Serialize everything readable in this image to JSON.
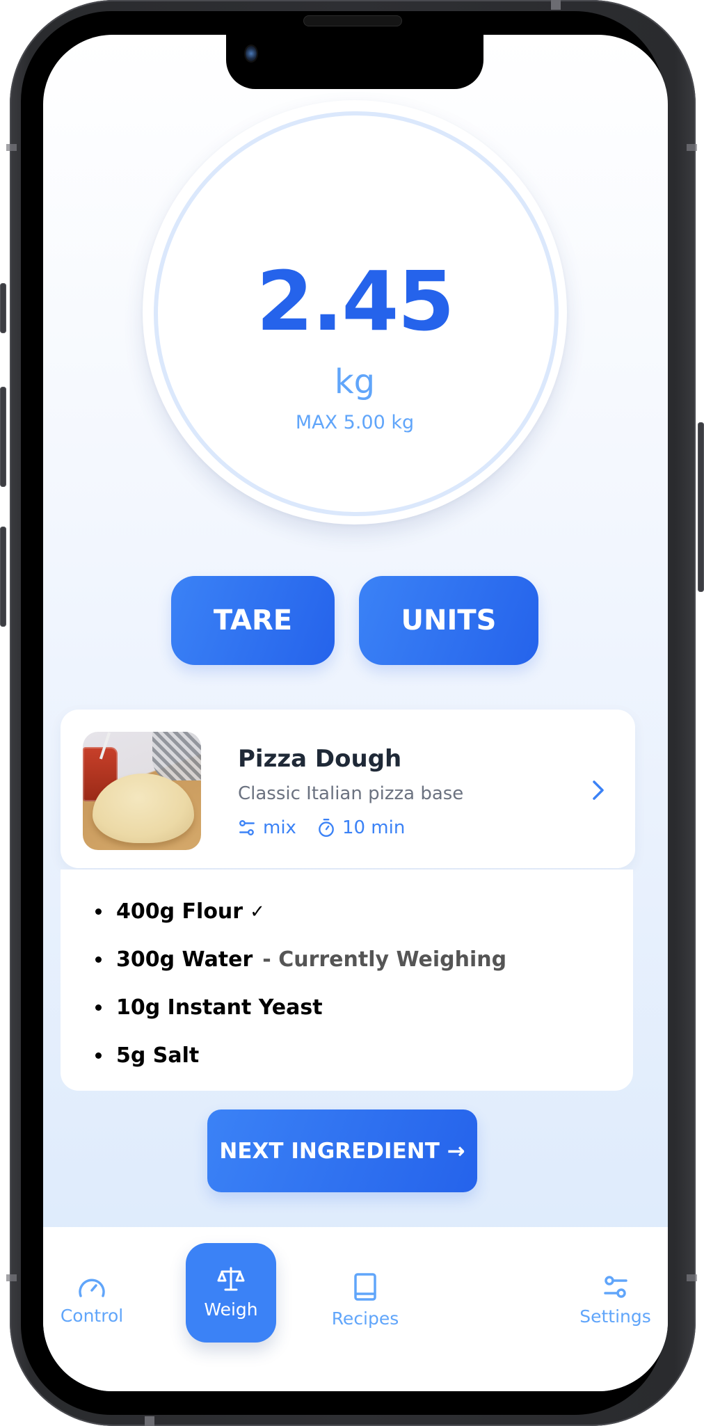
{
  "scale": {
    "weight_value": "2.45",
    "unit": "kg",
    "max_label": "MAX 5.00 kg",
    "capacity_fraction": 0.49
  },
  "controls": {
    "tare_label": "TARE",
    "units_label": "UNITS"
  },
  "recipe": {
    "title": "Pizza Dough",
    "description": "Classic Italian pizza base",
    "meta": [
      {
        "icon": "sliders-icon",
        "label": "mix"
      },
      {
        "icon": "stopwatch-icon",
        "label": "10 min"
      }
    ],
    "thumbnail_alt": "Pizza dough ball on wooden board with tomato sauce jar"
  },
  "ingredients": [
    {
      "label": "400g Flour",
      "status": "done",
      "check": "✓",
      "note": ""
    },
    {
      "label": "300g Water",
      "status": "current",
      "check": "",
      "note": "- Currently Weighing"
    },
    {
      "label": "10g Instant Yeast",
      "status": "pending",
      "check": "",
      "note": ""
    },
    {
      "label": "5g Salt",
      "status": "pending",
      "check": "",
      "note": ""
    }
  ],
  "next_button": {
    "label": "NEXT INGREDIENT →"
  },
  "nav": {
    "items": [
      {
        "label": "Control",
        "icon": "gauge-icon",
        "active": false
      },
      {
        "label": "Weigh",
        "icon": "scale-icon",
        "active": true
      },
      {
        "label": "Recipes",
        "icon": "book-icon",
        "active": false
      },
      {
        "label": "Settings",
        "icon": "sliders-icon",
        "active": false
      }
    ]
  },
  "colors": {
    "accent": "#2563eb",
    "accent_light": "#3b82f6",
    "muted_blue": "#60a5fa",
    "ring": "#dbe8fc",
    "text_dark": "#1f2937",
    "text_muted": "#6b7280"
  }
}
